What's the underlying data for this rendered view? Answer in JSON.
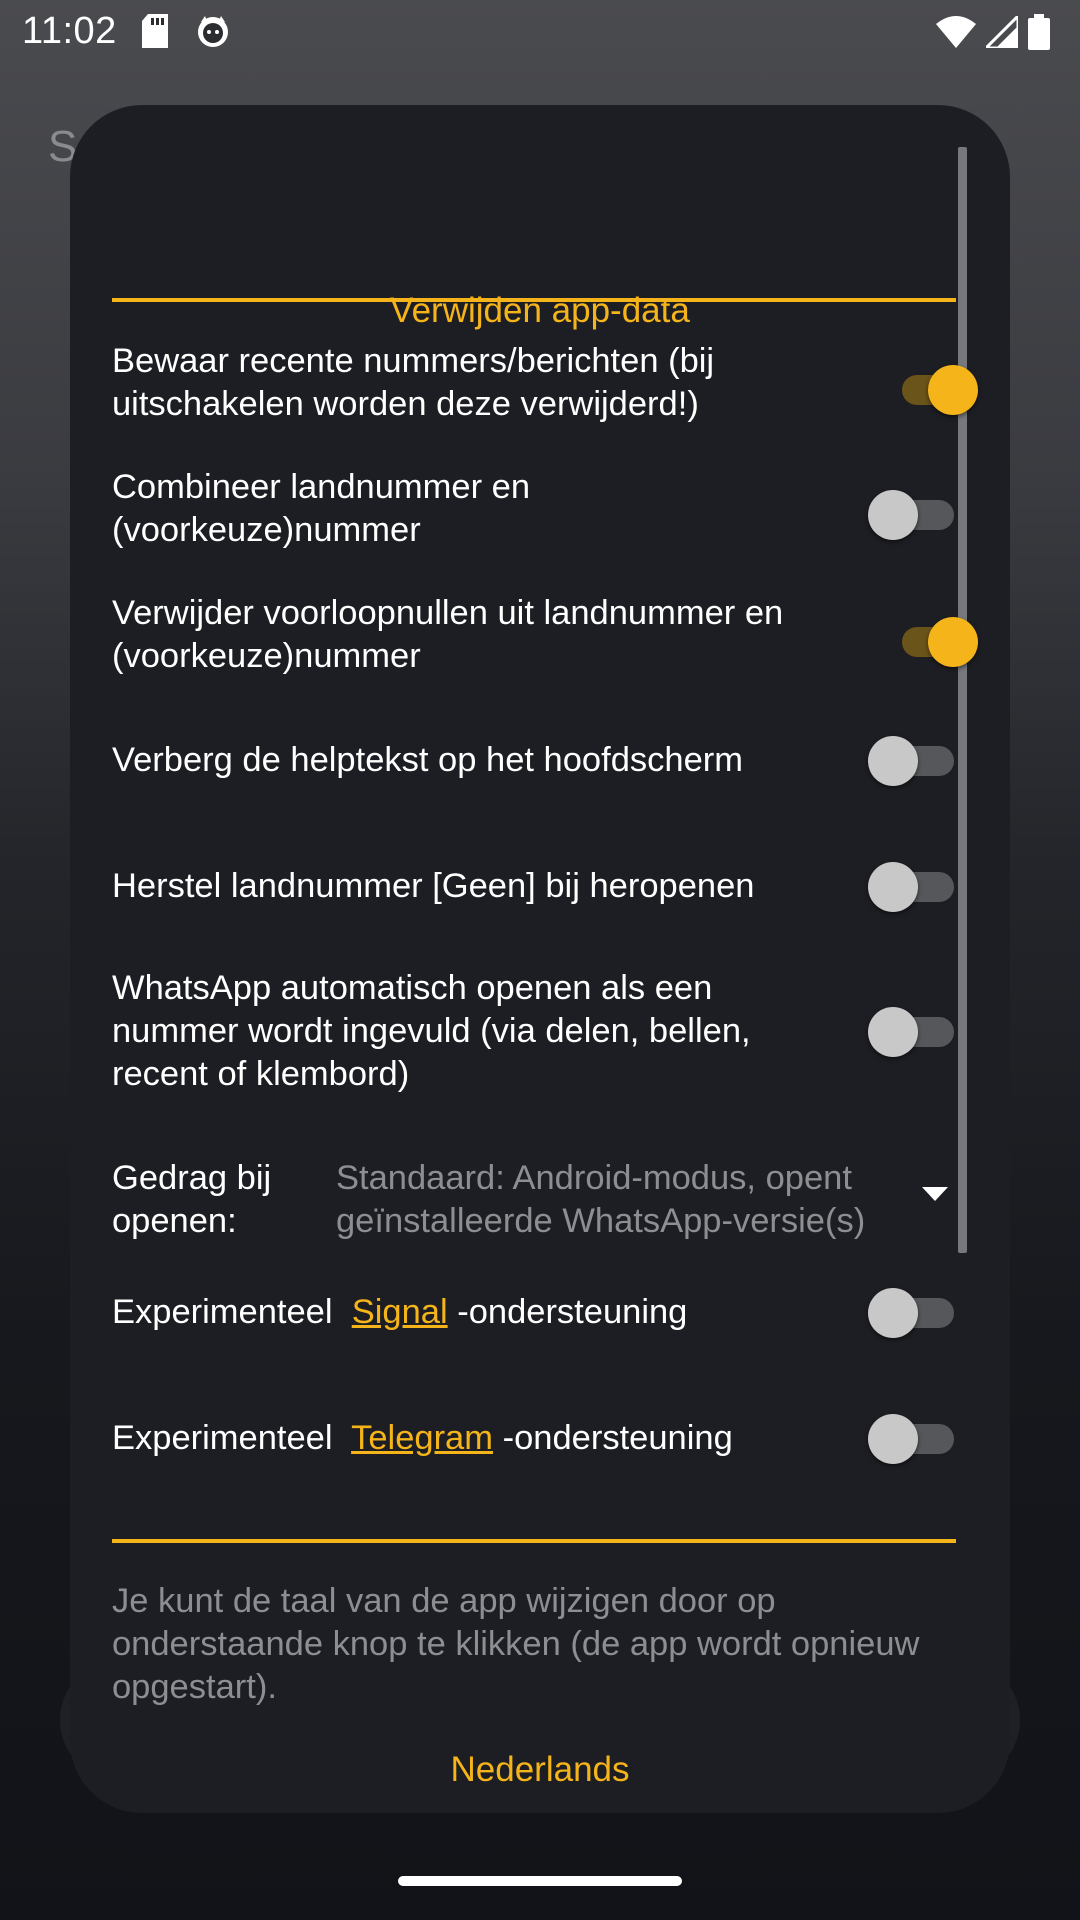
{
  "status_bar": {
    "time": "11:02",
    "left_icons": [
      "sd-card-icon",
      "cat-face-icon"
    ],
    "right_icons": [
      "wifi-icon",
      "signal-icon",
      "battery-icon"
    ]
  },
  "background": {
    "partial_letter": "S"
  },
  "dialog": {
    "title": "Verwijden app-data",
    "accent_color": "#f4b41a",
    "settings": [
      {
        "label": "Bewaar recente nummers/berichten (bij uitschakelen worden deze verwijderd!)",
        "enabled": true
      },
      {
        "label": "Combineer landnummer en (voorkeuze)nummer",
        "enabled": false
      },
      {
        "label": "Verwijder voorloopnullen uit landnummer en (voorkeuze)nummer",
        "enabled": true
      },
      {
        "label": "Verberg de helptekst op het hoofdscherm",
        "enabled": false
      },
      {
        "label": "Herstel landnummer [Geen] bij heropenen",
        "enabled": false
      },
      {
        "label": "WhatsApp automatisch openen als een nummer wordt ingevuld (via delen, bellen, recent of klembord)",
        "enabled": false
      }
    ],
    "open_behavior": {
      "label": "Gedrag bij openen:",
      "value": "Standaard: Android-modus, opent geïnstalleerde WhatsApp-versie(s)"
    },
    "signal_setting": {
      "prefix": "Experimenteel",
      "link": "Signal",
      "suffix": "-ondersteuning",
      "enabled": false
    },
    "telegram_setting": {
      "prefix": "Experimenteel",
      "link": "Telegram",
      "suffix": "-ondersteuning",
      "enabled": false
    },
    "language_info": "Je kunt de taal van de app wijzigen door op onderstaande knop te klikken (de app wordt opnieuw opgestart).",
    "language_button": "Nederlands"
  }
}
